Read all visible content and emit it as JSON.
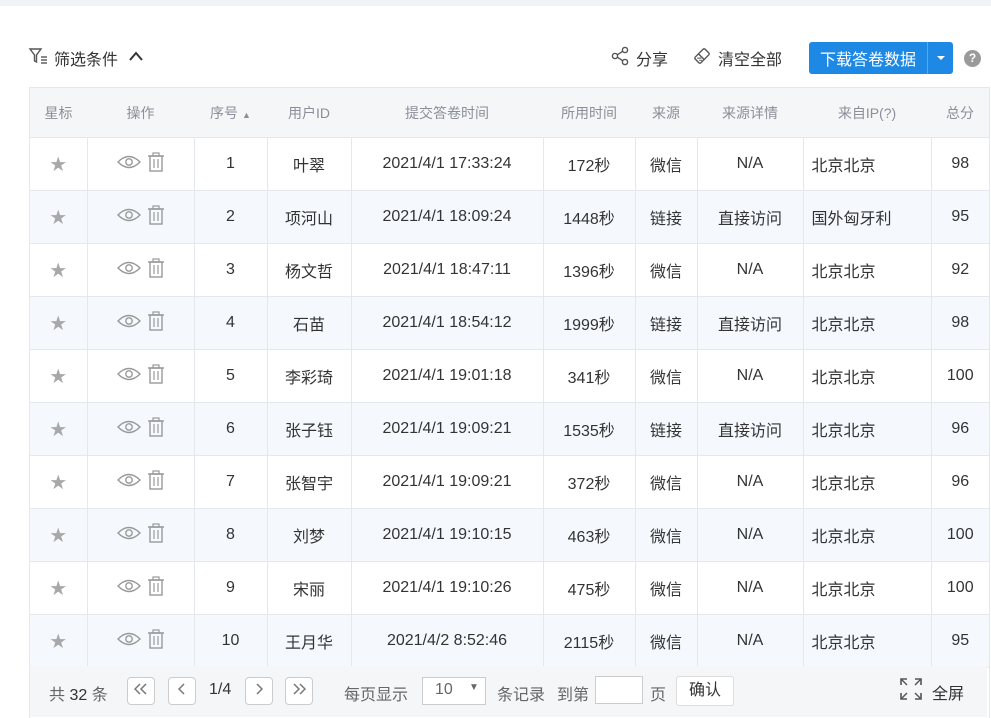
{
  "toolbar": {
    "filter_label": "筛选条件",
    "share_label": "分享",
    "clear_label": "清空全部",
    "download_label": "下载答卷数据",
    "help_label": "?"
  },
  "table": {
    "headers": [
      "星标",
      "操作",
      "序号",
      "用户ID",
      "提交答卷时间",
      "所用时间",
      "来源",
      "来源详情",
      "来自IP(?)",
      "总分"
    ],
    "sort_indicator": "▲",
    "rows": [
      {
        "no": "1",
        "user": "叶翠",
        "time": "2021/4/1 17:33:24",
        "duration": "172秒",
        "source": "微信",
        "detail": "N/A",
        "ip": "北京北京",
        "score": "98"
      },
      {
        "no": "2",
        "user": "项河山",
        "time": "2021/4/1 18:09:24",
        "duration": "1448秒",
        "source": "链接",
        "detail": "直接访问",
        "ip": "国外匈牙利",
        "score": "95"
      },
      {
        "no": "3",
        "user": "杨文哲",
        "time": "2021/4/1 18:47:11",
        "duration": "1396秒",
        "source": "微信",
        "detail": "N/A",
        "ip": "北京北京",
        "score": "92"
      },
      {
        "no": "4",
        "user": "石苗",
        "time": "2021/4/1 18:54:12",
        "duration": "1999秒",
        "source": "链接",
        "detail": "直接访问",
        "ip": "北京北京",
        "score": "98"
      },
      {
        "no": "5",
        "user": "李彩琦",
        "time": "2021/4/1 19:01:18",
        "duration": "341秒",
        "source": "微信",
        "detail": "N/A",
        "ip": "北京北京",
        "score": "100"
      },
      {
        "no": "6",
        "user": "张子钰",
        "time": "2021/4/1 19:09:21",
        "duration": "1535秒",
        "source": "链接",
        "detail": "直接访问",
        "ip": "北京北京",
        "score": "96"
      },
      {
        "no": "7",
        "user": "张智宇",
        "time": "2021/4/1 19:09:21",
        "duration": "372秒",
        "source": "微信",
        "detail": "N/A",
        "ip": "北京北京",
        "score": "96"
      },
      {
        "no": "8",
        "user": "刘梦",
        "time": "2021/4/1 19:10:15",
        "duration": "463秒",
        "source": "微信",
        "detail": "N/A",
        "ip": "北京北京",
        "score": "100"
      },
      {
        "no": "9",
        "user": "宋丽",
        "time": "2021/4/1 19:10:26",
        "duration": "475秒",
        "source": "微信",
        "detail": "N/A",
        "ip": "北京北京",
        "score": "100"
      },
      {
        "no": "10",
        "user": "王月华",
        "time": "2021/4/2 8:52:46",
        "duration": "2115秒",
        "source": "微信",
        "detail": "N/A",
        "ip": "北京北京",
        "score": "95"
      }
    ],
    "star_glyph": "★"
  },
  "pager": {
    "total_prefix": "共",
    "total_count": "32",
    "total_suffix": "条",
    "page_info": "1/4",
    "per_page_label": "每页显示",
    "per_page_value": "10",
    "records_label": "条记录",
    "goto_label": "到第",
    "page_label": "页",
    "confirm_label": "确认",
    "fullscreen_label": "全屏"
  },
  "colors": {
    "accent": "#1e88e5",
    "header_bg": "#f5f6f8",
    "alt_row_bg": "#f5f9fd",
    "icon_gray": "#a8a8a8"
  },
  "icons": {
    "filter": "filter-icon",
    "collapse": "chevron-up-icon",
    "share": "share-icon",
    "clear": "eraser-icon",
    "dropdown": "caret-down-icon",
    "help": "question-icon",
    "star": "star-icon",
    "view": "eye-icon",
    "delete": "trash-icon",
    "first": "double-chevron-left-icon",
    "prev": "chevron-left-icon",
    "next": "chevron-right-icon",
    "last": "double-chevron-right-icon",
    "fullscreen": "fullscreen-icon"
  }
}
